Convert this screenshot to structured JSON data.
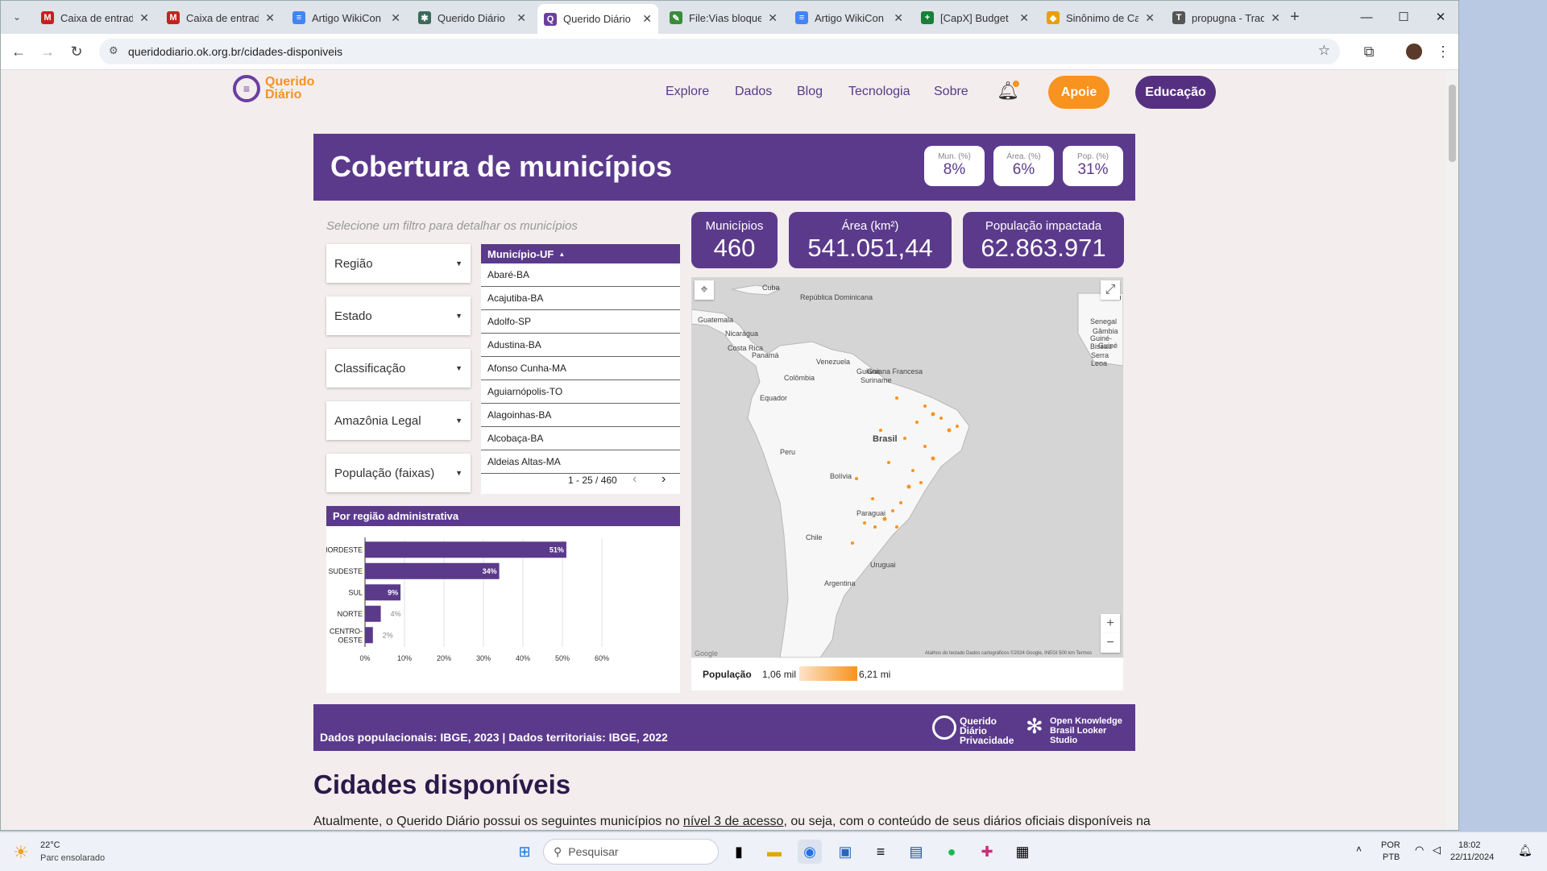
{
  "browser": {
    "tabs": [
      {
        "label": "Caixa de entrad",
        "icon": "gmail-icon",
        "color": "#c5221f",
        "glyph": "M"
      },
      {
        "label": "Caixa de entrad",
        "icon": "gmail-icon",
        "color": "#c5221f",
        "glyph": "M"
      },
      {
        "label": "Artigo WikiCon",
        "icon": "docs-icon",
        "color": "#4285f4",
        "glyph": "≡"
      },
      {
        "label": "Querido Diário",
        "icon": "gear-icon",
        "color": "#3a6b5a",
        "glyph": "✱"
      },
      {
        "label": "Querido Diário",
        "icon": "querido-diario-icon",
        "color": "#6a3fa0",
        "glyph": "Q"
      },
      {
        "label": "File:Vias bloque",
        "icon": "wikimedia-icon",
        "color": "#3a8c3a",
        "glyph": "✎"
      },
      {
        "label": "Artigo WikiCon",
        "icon": "docs-icon",
        "color": "#4285f4",
        "glyph": "≡"
      },
      {
        "label": "[CapX] Budget",
        "icon": "sheets-icon",
        "color": "#188038",
        "glyph": "+"
      },
      {
        "label": "Sinônimo de Ca",
        "icon": "dictionary-icon",
        "color": "#e8a000",
        "glyph": "◆"
      },
      {
        "label": "propugna - Trad",
        "icon": "translate-icon",
        "color": "#555555",
        "glyph": "T"
      }
    ],
    "active_tab": 4,
    "url": "queridodiario.ok.org.br/cidades-disponiveis"
  },
  "site": {
    "logo_line1": "Querido",
    "logo_line2": "Diário",
    "nav": [
      "Explore",
      "Dados",
      "Blog",
      "Tecnologia",
      "Sobre"
    ],
    "apoie": "Apoie",
    "educacao": "Educação"
  },
  "report": {
    "title": "Cobertura de municípios",
    "mini": [
      {
        "label": "Mun. (%)",
        "value": "8%"
      },
      {
        "label": "Área. (%)",
        "value": "6%"
      },
      {
        "label": "Pop. (%)",
        "value": "31%"
      }
    ],
    "filter_hint": "Selecione um filtro para detalhar os municípios",
    "filters": [
      "Região",
      "Estado",
      "Classificação",
      "Amazônia Legal",
      "População (faixas)"
    ],
    "table_header": "Município-UF",
    "sort_arrow": "▲",
    "rows": [
      "Abaré-BA",
      "Acajutiba-BA",
      "Adolfo-SP",
      "Adustina-BA",
      "Afonso Cunha-MA",
      "Aguiarnópolis-TO",
      "Alagoinhas-BA",
      "Alcobaça-BA",
      "Aldeias Altas-MA"
    ],
    "pager": "1 - 25 / 460",
    "stats": [
      {
        "label": "Municípios",
        "value": "460"
      },
      {
        "label": "Área (km²)",
        "value": "541.051,44"
      },
      {
        "label": "População impactada",
        "value": "62.863.971"
      }
    ],
    "chart_title": "Por região administrativa",
    "map": {
      "labels": [
        "Cuba",
        "República Dominicana",
        "Guatemala",
        "Nicarágua",
        "Costa Rica",
        "Panamá",
        "Venezuela",
        "Guiana",
        "Suriname",
        "Guiana Francesa",
        "Colômbia",
        "Equador",
        "Peru",
        "Brasil",
        "Bolívia",
        "Paraguai",
        "Chile",
        "Argentina",
        "Uruguai",
        "Senegal",
        "Gâmbia",
        "Guiné-Bissau",
        "Guiné",
        "Serra Leoa",
        "Mau"
      ],
      "attribution": "Atalhos do teclado  Dados cartográficos ©2024 Google, INEGI  500 km  Termos",
      "google": "Google"
    },
    "legend": {
      "label": "População",
      "min": "1,06 mil",
      "max": "6,21 mi",
      "color": "#f7931e"
    },
    "footer_sources": "Dados populacionais: IBGE, 2023   |   Dados territoriais: IBGE, 2022",
    "footer_brand1": "Querido Diário Privacidade",
    "footer_brand2": "Open Knowledge Brasil Looker Studio"
  },
  "page": {
    "heading": "Cidades disponíveis",
    "para_before": "Atualmente, o Querido Diário possui os seguintes municípios no ",
    "para_link": "nível 3 de acesso",
    "para_after": ", ou seja, com o conteúdo de seus diários oficiais disponíveis na"
  },
  "chart_data": {
    "type": "bar",
    "orientation": "horizontal",
    "title": "Por região administrativa",
    "categories": [
      "NORDESTE",
      "SUDESTE",
      "SUL",
      "NORTE",
      "CENTRO-OESTE"
    ],
    "values": [
      51,
      34,
      9,
      4,
      2
    ],
    "labels": [
      "51%",
      "34%",
      "9%",
      "4%",
      "2%"
    ],
    "xticks": [
      "0%",
      "10%",
      "20%",
      "30%",
      "40%",
      "50%",
      "60%"
    ],
    "xlim": [
      0,
      60
    ],
    "color": "#5b3a8c",
    "grid": true
  },
  "taskbar": {
    "weather_temp": "22°C",
    "weather_desc": "Parc ensolarado",
    "search": "Pesquisar",
    "lang1": "POR",
    "lang2": "PTB",
    "time": "18:02",
    "date": "22/11/2024"
  }
}
